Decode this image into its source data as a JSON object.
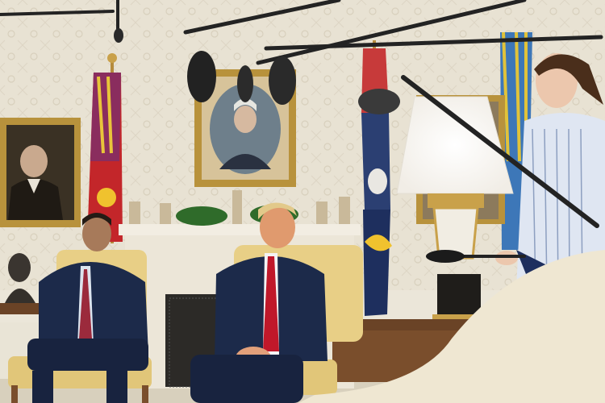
{
  "scene": {
    "kind": "photograph",
    "subject": "press-briefing-room",
    "colors": {
      "wall": "#e7e1d2",
      "wall_pattern": "#d9d2c0",
      "gold_frame": "#b8923c",
      "armchair": "#e8cf86",
      "suit_navy": "#1c2a4a",
      "tie_red": "#c0182a",
      "flag_navy": "#1e2f5e",
      "carpet": "#d8d0bd",
      "mantel": "#efe9dc"
    }
  },
  "elements": {
    "portrait_left": "portrait-painting",
    "portrait_center": "portrait-painting",
    "fireplace": "fireplace",
    "lamp": "table-lamp",
    "microphones": "boom-microphones",
    "people": [
      "seated-man-left",
      "seated-man-center",
      "standing-woman-right"
    ]
  }
}
